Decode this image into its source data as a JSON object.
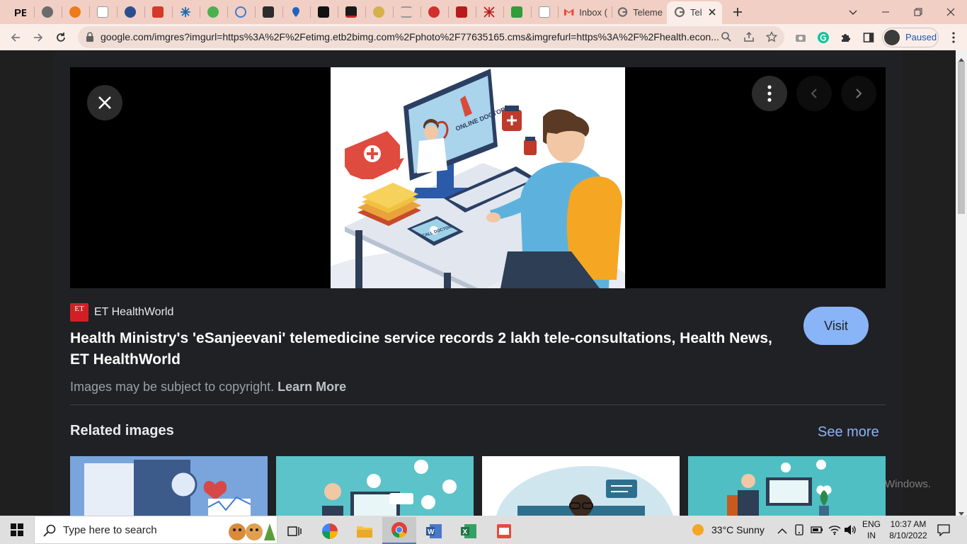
{
  "browser": {
    "tabs": {
      "favicons": [
        "pb-logo-icon",
        "gray-circle-icon",
        "orange-circle-icon",
        "news-site-icon",
        "blue-swirl-icon",
        "red-w-icon",
        "snowflake-icon",
        "green-circle-icon",
        "blue-circle-icon",
        "dark-cube-icon",
        "blue-pin-icon",
        "mm-icon",
        "dark-app-icon",
        "yellow-circle-icon",
        "gray-lines-icon",
        "red-circle-icon",
        "red-screen-icon",
        "red-pattern-icon",
        "green-leaf-icon",
        "news-site-icon-2"
      ],
      "gmail_tab": "Inbox (",
      "google_tab": "Teleme",
      "active_tab": "Tel"
    },
    "url": "google.com/imgres?imgurl=https%3A%2F%2Fetimg.etb2bimg.com%2Fphoto%2F77635165.cms&imgrefurl=https%3A%2F%2Fhealth.econ...",
    "profile_label": "Paused"
  },
  "page": {
    "source_logo": "ET",
    "source_name": "ET HealthWorld",
    "title": "Health Ministry's 'eSanjeevani' telemedicine service records 2 lakh tele-consultations, Health News, ET HealthWorld",
    "copyright_text": "Images may be subject to copyright.",
    "learn_more": "Learn More",
    "visit_label": "Visit",
    "related_title": "Related images",
    "see_more": "See more",
    "image_labels": {
      "screen": "ONLINE DOCTOR",
      "phone": "CALL DOCTOR"
    },
    "watermark": "Windows."
  },
  "taskbar": {
    "search_placeholder": "Type here to search",
    "weather": "33°C  Sunny",
    "language_top": "ENG",
    "language_bottom": "IN",
    "time": "10:37 AM",
    "date": "8/10/2022"
  },
  "colors": {
    "accent": "#8ab4f8",
    "tabstrip": "#f1cfc4",
    "toolbar": "#fbeee9"
  }
}
